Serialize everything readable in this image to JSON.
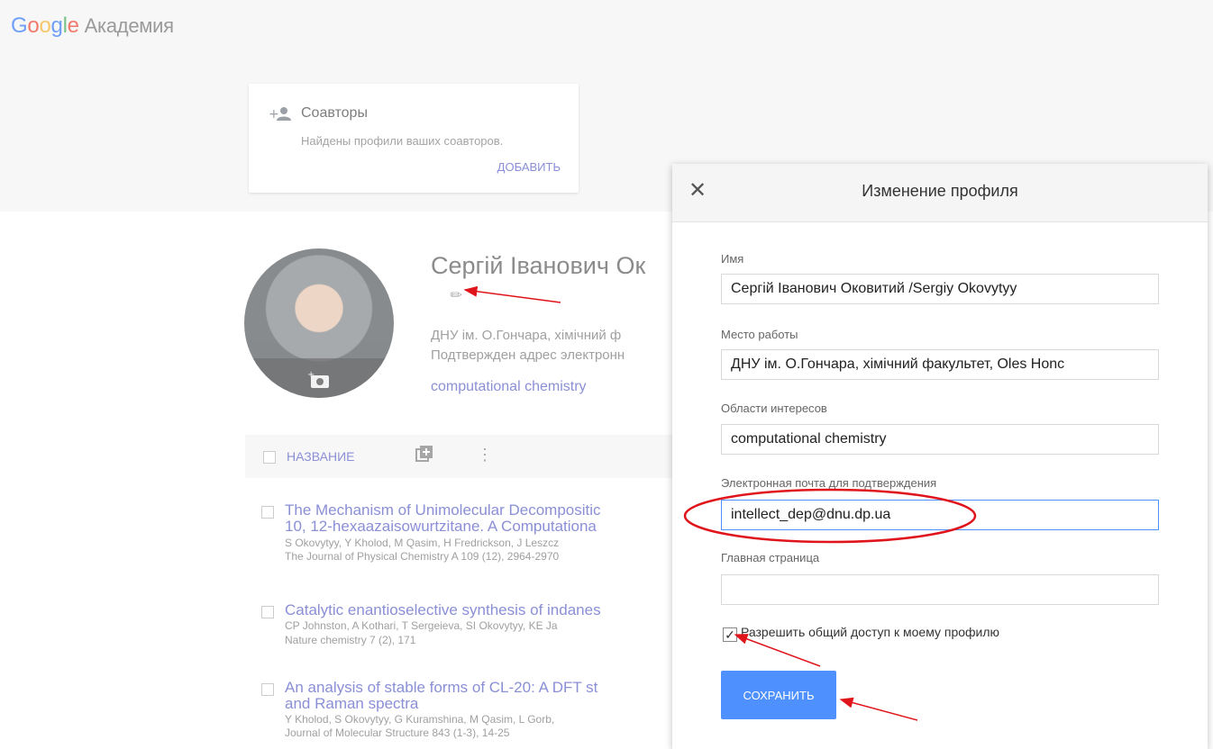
{
  "header": {
    "logo_google": [
      "G",
      "o",
      "o",
      "g",
      "l",
      "e"
    ],
    "product": "Академия"
  },
  "coauthors_card": {
    "icon": "add-person-icon",
    "title": "Соавторы",
    "subtitle": "Найдены профили ваших соавторов.",
    "action": "ДОБАВИТЬ"
  },
  "profile": {
    "name": "Сергій Іванович Ок",
    "affiliation_line1": "ДНУ ім. О.Гончара, хімічний ф",
    "affiliation_line2": "Подтвержден адрес электронн",
    "interest": "computational chemistry",
    "photo_icon": "add-photo-icon",
    "edit_icon": "pencil-icon"
  },
  "table": {
    "column_title": "НАЗВАНИЕ",
    "articles": [
      {
        "title_line1": "The Mechanism of Unimolecular Decompositic",
        "title_line2": "10, 12-hexaazaisowurtzitane. A Computationa",
        "authors": "S Okovytyy, Y Kholod, M Qasim, H Fredrickson, J Leszcz",
        "source": "The Journal of Physical Chemistry A 109 (12), 2964-2970"
      },
      {
        "title_line1": "Catalytic enantioselective synthesis of indanes",
        "authors": "CP Johnston, A Kothari, T Sergeieva, SI Okovytyy, KE Ja",
        "source": "Nature chemistry 7 (2), 171"
      },
      {
        "title_line1": "An analysis of stable forms of CL-20: A DFT st",
        "title_line2": "and Raman spectra",
        "authors": "Y Kholod, S Okovytyy, G Kuramshina, M Qasim, L Gorb,",
        "source": "Journal of Molecular Structure 843 (1-3), 14-25"
      }
    ]
  },
  "modal": {
    "title": "Изменение профиля",
    "close_icon": "close-icon",
    "fields": {
      "name_label": "Имя",
      "name_value": "Сергій Іванович Оковитий /Sergiy Okovytyy",
      "work_label": "Место работы",
      "work_value": "ДНУ ім. О.Гончара, хімічний факультет, Oles Honc",
      "interests_label": "Области интересов",
      "interests_value": "computational chemistry",
      "email_label": "Электронная почта для подтверждения",
      "email_value": "intellect_dep@dnu.dp.ua",
      "homepage_label": "Главная страница",
      "homepage_value": ""
    },
    "share_label": "Разрешить общий доступ к моему профилю",
    "share_checked": true,
    "save_label": "СОХРАНИТЬ"
  },
  "annotation_color": "#e0151b"
}
